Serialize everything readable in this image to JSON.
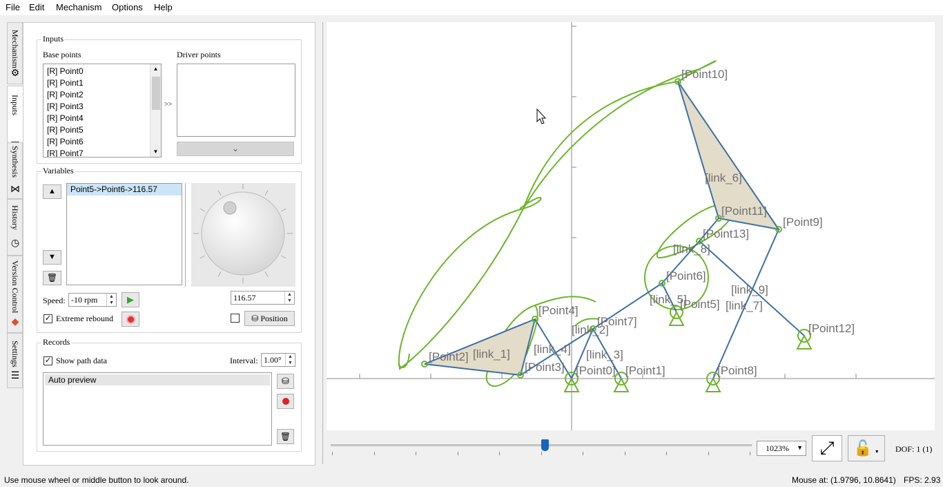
{
  "menu": [
    "File",
    "Edit",
    "Mechanism",
    "Options",
    "Help"
  ],
  "tabs": [
    {
      "label": "Mechanism",
      "icon": "gear-icon"
    },
    {
      "label": "Inputs",
      "icon": "input-icon"
    },
    {
      "label": "Synthesis",
      "icon": "synthesis-icon"
    },
    {
      "label": "History",
      "icon": "history-icon"
    },
    {
      "label": "Version Control",
      "icon": "git-icon"
    },
    {
      "label": "Settings",
      "icon": "sliders-icon"
    }
  ],
  "inputs": {
    "group_title": "Inputs",
    "base_points_label": "Base points",
    "driver_points_label": "Driver points",
    "base_points": [
      "[R] Point0",
      "[R] Point1",
      "[R] Point2",
      "[R] Point3",
      "[R] Point4",
      "[R] Point5",
      "[R] Point6",
      "[R] Point7"
    ],
    "add_arrow": ">>"
  },
  "variables": {
    "group_title": "Variables",
    "items": [
      "Point5->Point6->116.57"
    ],
    "speed_label": "Speed:",
    "speed_value": "-10 rpm",
    "angle_value": "116.57",
    "extreme_rebound_label": "Extreme rebound",
    "position_label": "Position"
  },
  "records": {
    "group_title": "Records",
    "show_path_label": "Show path data",
    "interval_label": "Interval:",
    "interval_value": "1.00°",
    "items": [
      "Auto preview"
    ]
  },
  "canvas_labels": {
    "point10": "[Point10]",
    "link6": "[link_6]",
    "point11": "[Point11]",
    "point9": "[Point9]",
    "point13": "[Point13]",
    "link8": "[link_8]",
    "point6": "[Point6]",
    "link5": "[link_5]",
    "point5": "[Point5]",
    "link9": "[link_9]",
    "link7": "[link_7]",
    "point4": "[Point4]",
    "point7": "[Point7]",
    "link2": "[link_2]",
    "link4": "[link_4]",
    "link3": "[link_3]",
    "point2": "[Point2]",
    "link1": "[link_1]",
    "point3": "[Point3]",
    "point0": "[Point0]",
    "point1": "[Point1]",
    "point8": "[Point8]",
    "point12": "[Point12]"
  },
  "view": {
    "zoom": "1023%",
    "slider_fraction": 0.51,
    "dof": "DOF:  1 (1)"
  },
  "status": {
    "hint": "Use mouse wheel or middle button to look around.",
    "mouse": "Mouse at: (1.9796, 10.8641)",
    "fps": "FPS:   2.93"
  },
  "colors": {
    "link": "#3c6fa6",
    "path": "#6cb52a",
    "triangle": "#e3dcc8",
    "accent": "#1565c0"
  }
}
